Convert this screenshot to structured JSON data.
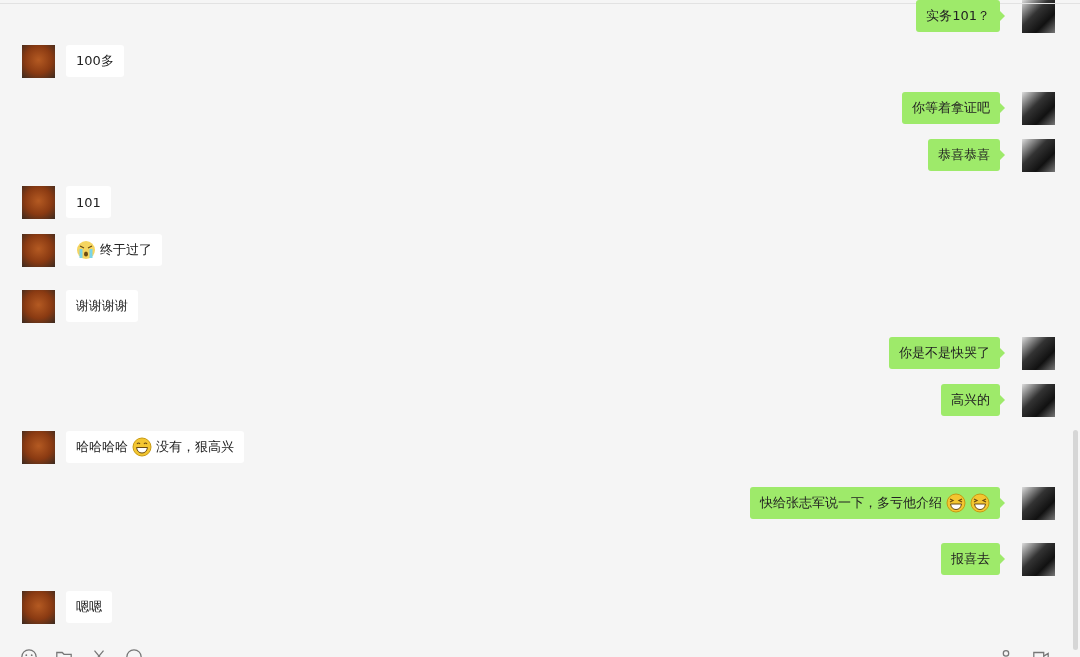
{
  "messages": [
    {
      "kind": "sent",
      "parts": [
        {
          "kind": "text",
          "text": "实务101？"
        }
      ]
    },
    {
      "kind": "received",
      "parts": [
        {
          "kind": "text",
          "text": "100多"
        }
      ]
    },
    {
      "kind": "sent",
      "parts": [
        {
          "kind": "text",
          "text": "你等着拿证吧"
        }
      ]
    },
    {
      "kind": "sent",
      "parts": [
        {
          "kind": "text",
          "text": "恭喜恭喜"
        }
      ]
    },
    {
      "kind": "received",
      "parts": [
        {
          "kind": "text",
          "text": "101"
        }
      ]
    },
    {
      "kind": "received",
      "parts": [
        {
          "kind": "crying"
        },
        {
          "kind": "text",
          "text": "终于过了"
        }
      ]
    },
    {
      "kind": "received",
      "parts": [
        {
          "kind": "text",
          "text": "谢谢谢谢"
        }
      ]
    },
    {
      "kind": "sent",
      "parts": [
        {
          "kind": "text",
          "text": "你是不是快哭了"
        }
      ]
    },
    {
      "kind": "sent",
      "parts": [
        {
          "kind": "text",
          "text": "高兴的"
        }
      ]
    },
    {
      "kind": "received",
      "parts": [
        {
          "kind": "text",
          "text": "哈哈哈哈"
        },
        {
          "kind": "grin"
        },
        {
          "kind": "text",
          "text": "没有，狠高兴"
        }
      ]
    },
    {
      "kind": "sent",
      "parts": [
        {
          "kind": "text",
          "text": "快给张志军说一下，多亏他介绍"
        },
        {
          "kind": "laugh"
        },
        {
          "kind": "laugh"
        }
      ]
    },
    {
      "kind": "sent",
      "parts": [
        {
          "kind": "text",
          "text": "报喜去"
        }
      ]
    },
    {
      "kind": "received",
      "parts": [
        {
          "kind": "text",
          "text": "嗯嗯"
        }
      ]
    }
  ]
}
